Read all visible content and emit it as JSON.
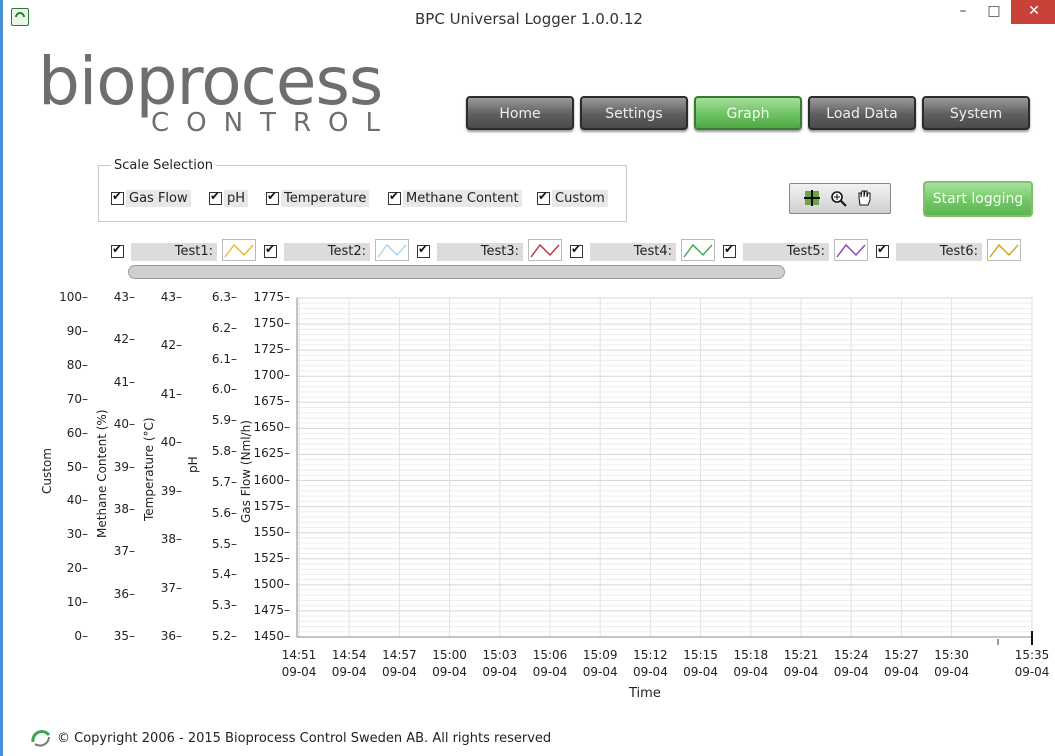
{
  "window": {
    "title": "BPC Universal Logger 1.0.0.12",
    "minimize": "–",
    "maximize": "□",
    "close": "✕"
  },
  "logo": {
    "main": "bioprocess",
    "sub": "CONTROL"
  },
  "nav": [
    {
      "label": "Home",
      "active": false
    },
    {
      "label": "Settings",
      "active": false
    },
    {
      "label": "Graph",
      "active": true
    },
    {
      "label": "Load Data",
      "active": false
    },
    {
      "label": "System",
      "active": false
    }
  ],
  "scale_selection": {
    "title": "Scale Selection",
    "options": [
      {
        "label": "Gas Flow",
        "checked": true
      },
      {
        "label": "pH",
        "checked": true
      },
      {
        "label": "Temperature",
        "checked": true
      },
      {
        "label": "Methane Content",
        "checked": true
      },
      {
        "label": "Custom",
        "checked": true
      }
    ]
  },
  "tools": {
    "icons": [
      "cursor-crosshair-icon",
      "zoom-icon",
      "pan-hand-icon"
    ]
  },
  "start_logging": "Start logging",
  "legend": [
    {
      "label": "Test1:",
      "checked": true,
      "color": "#e8b830"
    },
    {
      "label": "Test2:",
      "checked": true,
      "color": "#a8d4ee"
    },
    {
      "label": "Test3:",
      "checked": true,
      "color": "#c0303a"
    },
    {
      "label": "Test4:",
      "checked": true,
      "color": "#3ea650"
    },
    {
      "label": "Test5:",
      "checked": true,
      "color": "#8a3fc4"
    },
    {
      "label": "Test6:",
      "checked": true,
      "color": "#d4a020"
    }
  ],
  "chart_data": {
    "type": "line",
    "series": [],
    "xlabel": "Time",
    "x_ticks": [
      [
        "14:51",
        "09-04"
      ],
      [
        "14:54",
        "09-04"
      ],
      [
        "14:57",
        "09-04"
      ],
      [
        "15:00",
        "09-04"
      ],
      [
        "15:03",
        "09-04"
      ],
      [
        "15:06",
        "09-04"
      ],
      [
        "15:09",
        "09-04"
      ],
      [
        "15:12",
        "09-04"
      ],
      [
        "15:15",
        "09-04"
      ],
      [
        "15:18",
        "09-04"
      ],
      [
        "15:21",
        "09-04"
      ],
      [
        "15:24",
        "09-04"
      ],
      [
        "15:27",
        "09-04"
      ],
      [
        "15:30",
        "09-04"
      ],
      [
        "15:35",
        "09-04"
      ]
    ],
    "y_axes": [
      {
        "label": "Custom",
        "ticks": [
          "100",
          "90",
          "80",
          "70",
          "60",
          "50",
          "40",
          "30",
          "20",
          "10",
          "0"
        ]
      },
      {
        "label": "Methane Content (%)",
        "ticks": [
          "43",
          "42",
          "41",
          "40",
          "39",
          "38",
          "37",
          "36",
          "35"
        ]
      },
      {
        "label": "Temperature (°C)",
        "ticks": [
          "43",
          "42",
          "41",
          "40",
          "39",
          "38",
          "37",
          "36"
        ]
      },
      {
        "label": "pH",
        "ticks": [
          "6.3",
          "6.2",
          "6.1",
          "6.0",
          "5.9",
          "5.8",
          "5.7",
          "5.6",
          "5.5",
          "5.4",
          "5.3",
          "5.2"
        ]
      },
      {
        "label": "Gas Flow (Nml/h)",
        "ticks": [
          "1775",
          "1750",
          "1725",
          "1700",
          "1675",
          "1650",
          "1625",
          "1600",
          "1575",
          "1550",
          "1525",
          "1500",
          "1475",
          "1450"
        ]
      }
    ],
    "grid": true
  },
  "footer": {
    "copyright": "© Copyright 2006 - 2015 Bioprocess Control Sweden AB. All rights reserved"
  }
}
